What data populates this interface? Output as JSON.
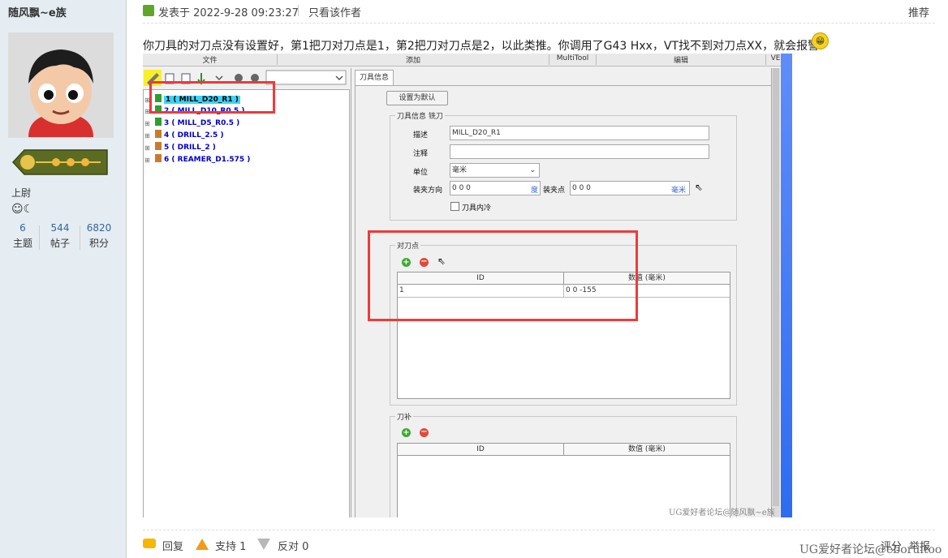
{
  "user": {
    "name": "随风飘~e族",
    "rank": "上尉",
    "medal": "☺☾",
    "stats": [
      {
        "value": "6",
        "label": "主题"
      },
      {
        "value": "544",
        "label": "帖子"
      },
      {
        "value": "6820",
        "label": "积分"
      }
    ]
  },
  "post": {
    "time": "发表于 2022-9-28 09:23:27",
    "only_author": "只看该作者",
    "recommend": "推荐",
    "text": "你刀具的对刀点没有设置好，第1把刀对刀点是1，第2把刀对刀点是2，以此类推。你调用了G43 Hxx，VT找不到对刀点XX，就会报警"
  },
  "screenshot": {
    "menu": [
      "文件",
      "添加",
      "MultiTool",
      "编辑",
      "VERI"
    ],
    "tools": [
      {
        "label": "1 ( MILL_D20_R1 )",
        "color": "#2e9e2e",
        "selected": true
      },
      {
        "label": "2 ( MILL_D10_R0.5 )",
        "color": "#2e9e2e",
        "selected": false
      },
      {
        "label": "3 ( MILL_D5_R0.5 )",
        "color": "#2e9e2e",
        "selected": false
      },
      {
        "label": "4 ( DRILL_2.5 )",
        "color": "#c87b2e",
        "selected": false
      },
      {
        "label": "5 ( DRILL_2 )",
        "color": "#c87b2e",
        "selected": false
      },
      {
        "label": "6 ( REAMER_D1.575 )",
        "color": "#c87b2e",
        "selected": false
      }
    ],
    "tab": "刀具信息",
    "set_default": "设置为默认",
    "info_group": "刀具信息 铣刀",
    "desc_label": "描述",
    "desc_value": "MILL_D20_R1",
    "note_label": "注释",
    "note_value": "",
    "unit_label": "单位",
    "unit_value": "毫米",
    "clamp_dir_label": "装夹方向",
    "clamp_dir_value": "0 0 0",
    "clamp_dir_unit": "度",
    "clamp_pt_label": "装夹点",
    "clamp_pt_value": "0 0 0",
    "clamp_pt_unit": "毫米",
    "coolant_label": "刀具内冷",
    "gauge_group": "对刀点",
    "gauge_table": {
      "headers": [
        "ID",
        "数值 (毫米)"
      ],
      "rows": [
        [
          "1",
          "0 0 -155"
        ]
      ]
    },
    "comp_group": "刀补",
    "comp_table": {
      "headers": [
        "ID",
        "数值 (毫米)"
      ],
      "rows": []
    },
    "watermark": "UG爱好者论坛@随风飘~e族"
  },
  "actions": {
    "reply": "回复",
    "support": "支持 1",
    "oppose": "反对 0",
    "rate": "评分",
    "report": "举报"
  },
  "watermark": "UG爱好者论坛@eboruitoo"
}
